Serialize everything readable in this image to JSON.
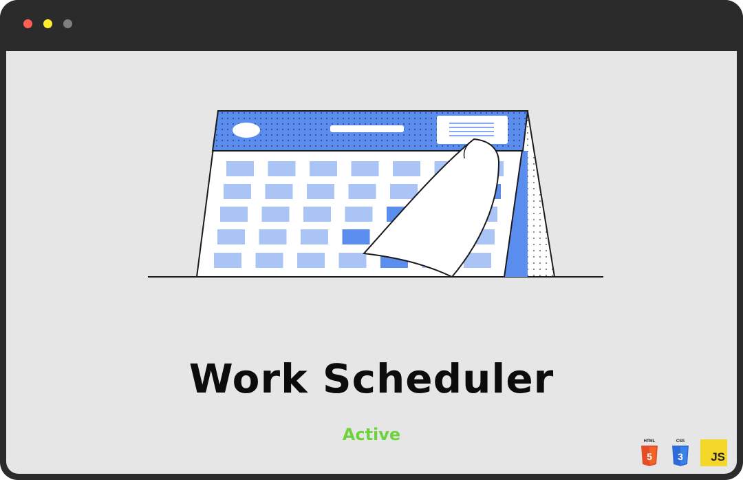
{
  "window": {
    "controls": [
      "close",
      "minimize",
      "maximize"
    ],
    "colors": {
      "close": "#ff5f57",
      "minimize": "#ffee2e",
      "maximize": "#7f7f7f",
      "frame": "#2b2b2b",
      "content_bg": "#e6e6e6"
    }
  },
  "project": {
    "title": "Work Scheduler",
    "status": "Active",
    "status_color": "#6ed23f",
    "illustration_icon": "calendar-page-flip-icon",
    "accent_color": "#5b8def"
  },
  "tech_badges": [
    {
      "name": "HTML",
      "icon": "html5-icon",
      "glyph": "5",
      "color": "#e44d26"
    },
    {
      "name": "CSS",
      "icon": "css3-icon",
      "glyph": "3",
      "color": "#2f6ad9"
    },
    {
      "name": "JS",
      "icon": "javascript-icon",
      "glyph": "JS",
      "color": "#f5d729"
    }
  ]
}
